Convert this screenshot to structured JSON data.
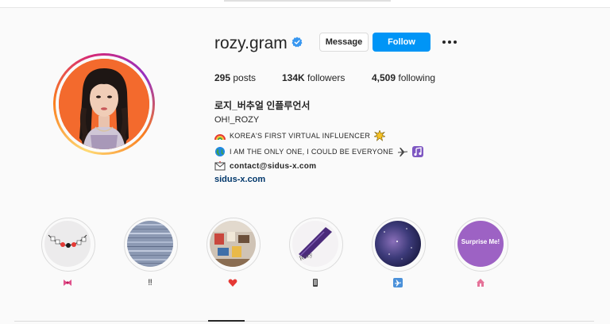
{
  "profile": {
    "username": "rozy.gram",
    "message_label": "Message",
    "follow_label": "Follow",
    "stats": {
      "posts_count": "295",
      "posts_label": "posts",
      "followers_count": "134K",
      "followers_label": "followers",
      "following_count": "4,509",
      "following_label": "following"
    },
    "bio": {
      "name": "로지_버추얼 인플루언서",
      "subtitle": "OH!_ROZY",
      "line1": "KOREA'S FIRST VIRTUAL INFLUENCER",
      "line2": "I AM THE ONLY ONE, I COULD BE EVERYONE",
      "email": "contact@sidus-x.com",
      "link": "sidus-x.com"
    }
  },
  "highlights": [
    {
      "label_icon": "ribbon-icon",
      "label": ""
    },
    {
      "label_icon": "double-exclamation-icon",
      "label": "‼"
    },
    {
      "label_icon": "heart-icon",
      "label": ""
    },
    {
      "label_icon": "phone-icon",
      "label": ""
    },
    {
      "label_icon": "airplane-icon",
      "label": ""
    },
    {
      "label_icon": "house-icon",
      "label": "",
      "image_text": "Surprise Me!"
    }
  ],
  "colors": {
    "follow": "#0095f6",
    "link": "#00376b",
    "verified": "#3897f0",
    "avatar_bg": "#f36a2d"
  }
}
